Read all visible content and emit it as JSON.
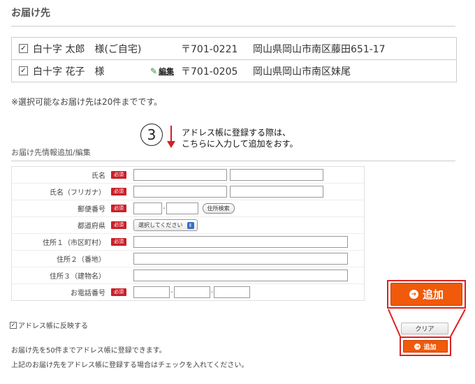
{
  "section": {
    "title": "お届け先"
  },
  "addresses": [
    {
      "checked": "☑",
      "name": "白十字 太郎　様(ご自宅)",
      "zip": "〒701-0221",
      "addr": "岡山県岡山市南区藤田651-17"
    },
    {
      "checked": "☑",
      "name": "白十字 花子　様",
      "edit": "編集",
      "zip": "〒701-0205",
      "addr": "岡山県岡山市南区妹尾"
    }
  ],
  "limit_note": "※選択可能なお届け先は20件までです。",
  "callout": {
    "number": "3",
    "line1": "アドレス帳に登録する際は、",
    "line2": "こちらに入力して追加をおす。"
  },
  "form": {
    "title": "お届け先情報追加/編集",
    "required_label": "必須",
    "labels": {
      "name": "氏名",
      "kana": "氏名（フリガナ）",
      "postal": "郵便番号",
      "prefecture": "都道府県",
      "addr1": "住所１（市区町村）",
      "addr2": "住所２（番地）",
      "addr3": "住所３（建物名）",
      "phone": "お電話番号"
    },
    "postal_search": "住所検索",
    "prefecture_select": "選択してください",
    "reflect_label": "アドレス帳に反映する"
  },
  "notes": {
    "line1": "お届け先を50件までアドレス帳に登録できます。",
    "line2": "上記のお届け先をアドレス帳に登録する場合はチェックを入れてください。"
  },
  "buttons": {
    "add": "追加",
    "clear": "クリア"
  },
  "colors": {
    "accent": "#f05a0a",
    "required": "#c8202a",
    "highlight": "#e02020"
  }
}
